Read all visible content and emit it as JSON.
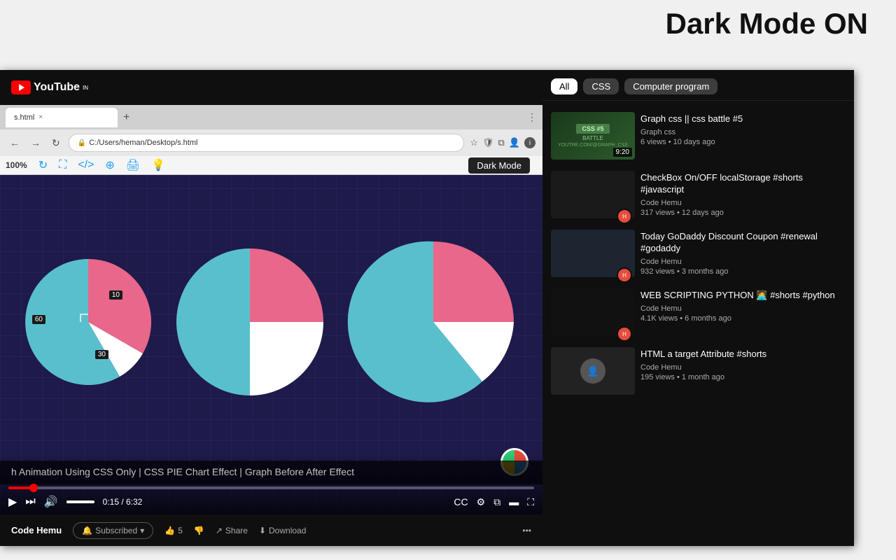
{
  "page": {
    "dark_mode_label": "Dark Mode ON",
    "dark_mode_button": "Dark Mode"
  },
  "browser": {
    "tab_title": "s.html",
    "tab_url": "C:/Users/heman/Desktop/s.html",
    "zoom": "100%",
    "new_tab_icon": "+",
    "close_icon": "×",
    "menu_dots": "⋮",
    "back_icon": "←",
    "forward_icon": "→",
    "refresh_icon": "↻",
    "home_icon": "⌂"
  },
  "toolbar": {
    "zoom": "100%",
    "icons": [
      "↻",
      "⛶",
      "</>",
      "⊕",
      "🖨",
      "💡"
    ]
  },
  "video": {
    "title": "h Animation Using CSS Only | CSS PIE Chart Effect | Graph Before After Effect",
    "channel": "Code Hemu",
    "progress_time": "0:15 / 6:32",
    "subscribe_label": "Subscribed",
    "like_count": "5",
    "share_label": "Share",
    "download_label": "Download",
    "more_icon": "•••"
  },
  "youtube": {
    "logo_text": "YouTube",
    "logo_suffix": "IN"
  },
  "pie_charts": [
    {
      "id": "chart1",
      "label_60": "60",
      "label_10": "10",
      "label_30": "30",
      "colors": {
        "pink": "#e8678a",
        "teal": "#5abfcd",
        "white": "#ffffff"
      }
    }
  ],
  "filters": [
    {
      "label": "All",
      "active": true
    },
    {
      "label": "CSS",
      "active": false
    },
    {
      "label": "Computer program",
      "active": false
    }
  ],
  "sidebar_videos": [
    {
      "title": "Graph css || css battle #5",
      "channel": "Graph css",
      "stats": "6 views • 10 days ago",
      "duration": "9:20",
      "thumb_type": "css-battle",
      "has_avatar": false
    },
    {
      "title": "CheckBox On/OFF localStorage #shorts #javascript",
      "channel": "Code Hemu",
      "stats": "317 views • 12 days ago",
      "duration": "",
      "thumb_type": "dark",
      "has_avatar": true
    },
    {
      "title": "Today GoDaddy Discount Coupon #renewal #godaddy",
      "channel": "Code Hemu",
      "stats": "932 views • 3 months ago",
      "duration": "",
      "thumb_type": "phone",
      "has_avatar": true
    },
    {
      "title": "WEB SCRIPTING PYTHON 🧑‍💻 #shorts #python",
      "channel": "Code Hemu",
      "stats": "4.1K views • 6 months ago",
      "duration": "",
      "thumb_type": "dark",
      "has_avatar": true
    },
    {
      "title": "HTML a target Attribute #shorts",
      "channel": "Code Hemu",
      "stats": "195 views • 1 month ago",
      "duration": "",
      "thumb_type": "avatar-only",
      "has_avatar": false
    }
  ]
}
